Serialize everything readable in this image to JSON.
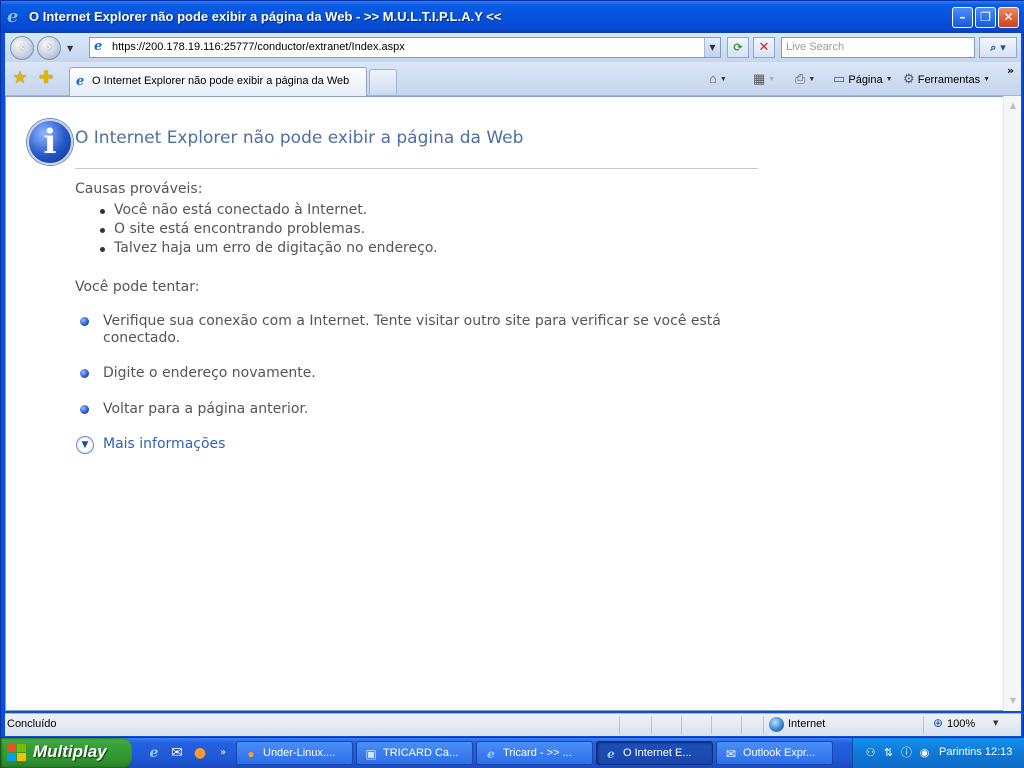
{
  "window": {
    "title": "O Internet Explorer não pode exibir a página da Web - >> M.U.L.T.I.P.L.A.Y <<"
  },
  "address_bar": {
    "url": "https://200.178.19.116:25777/conductor/extranet/Index.aspx",
    "search_placeholder": "Live Search"
  },
  "tab": {
    "label": "O Internet Explorer não pode exibir a página da Web"
  },
  "commands": {
    "page_label": "Página",
    "tools_label": "Ferramentas"
  },
  "content": {
    "title": "O Internet Explorer não pode exibir a página da Web",
    "causes_heading": "Causas prováveis:",
    "causes": [
      "Você não está conectado à Internet.",
      "O site está encontrando problemas.",
      "Talvez haja um erro de digitação no endereço."
    ],
    "try_heading": "Você pode tentar:",
    "try_items": [
      "Verifique sua conexão com a Internet. Tente visitar outro site para verificar se você está conectado.",
      "Digite o endereço novamente.",
      "Voltar para a página anterior."
    ],
    "more_info": "Mais informações"
  },
  "status_bar": {
    "status": "Concluído",
    "zone": "Internet",
    "zoom": "100%"
  },
  "taskbar": {
    "start_label": "Multiplay",
    "buttons": [
      "Under-Linux....",
      "TRICARD Ca...",
      "Tricard - >> ...",
      "O Internet E...",
      "Outlook Expr..."
    ],
    "clock_text": "Parintins 12:13"
  },
  "colors": {
    "title_blue": "#4e6fa2",
    "link_blue": "#2b63b5",
    "xp_blue": "#0a5ce6",
    "start_green": "#38a238"
  },
  "icons": {
    "info": "info-icon",
    "ie": "ie-icon",
    "home": "home-icon",
    "feeds": "rss-icon",
    "print": "printer-icon",
    "tools": "gear-icon",
    "zone": "globe-icon",
    "zoom": "zoom-icon"
  }
}
